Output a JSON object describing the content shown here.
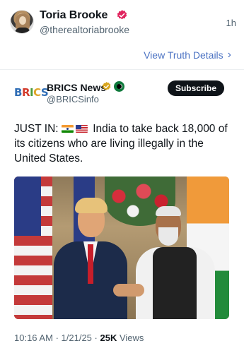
{
  "post": {
    "author": {
      "display_name": "Toria Brooke",
      "handle": "@therealtoriabrooke",
      "avatar_icon": "user-avatar"
    },
    "verified_icon": "verified-badge-icon",
    "time_ago": "1h",
    "view_details_label": "View Truth Details",
    "view_details_icon": "chevron-right-icon"
  },
  "quote": {
    "logo_text": {
      "b": "B",
      "r": "R",
      "i": "I",
      "c": "C",
      "s": "S"
    },
    "name": "BRICS News",
    "handle": "@BRICSinfo",
    "subscribe_label": "Subscribe",
    "badges": [
      "gold-verified-icon",
      "flag-badge-icon"
    ],
    "text_prefix": "JUST IN:",
    "text_body": "India to take back 18,000 of its citizens who are living illegally in the United States.",
    "flags": [
      "india-flag-icon",
      "us-flag-icon"
    ]
  },
  "footer": {
    "time": "10:16 AM",
    "sep1": "·",
    "date": "1/21/25",
    "sep2": "·",
    "views_count": "25K",
    "views_label": "Views"
  },
  "colors": {
    "accent_link": "#4c73c3",
    "verified_pink": "#e0245e",
    "verified_gold": "#d9a61e",
    "text_primary": "#0f1419",
    "text_secondary": "#536471"
  }
}
